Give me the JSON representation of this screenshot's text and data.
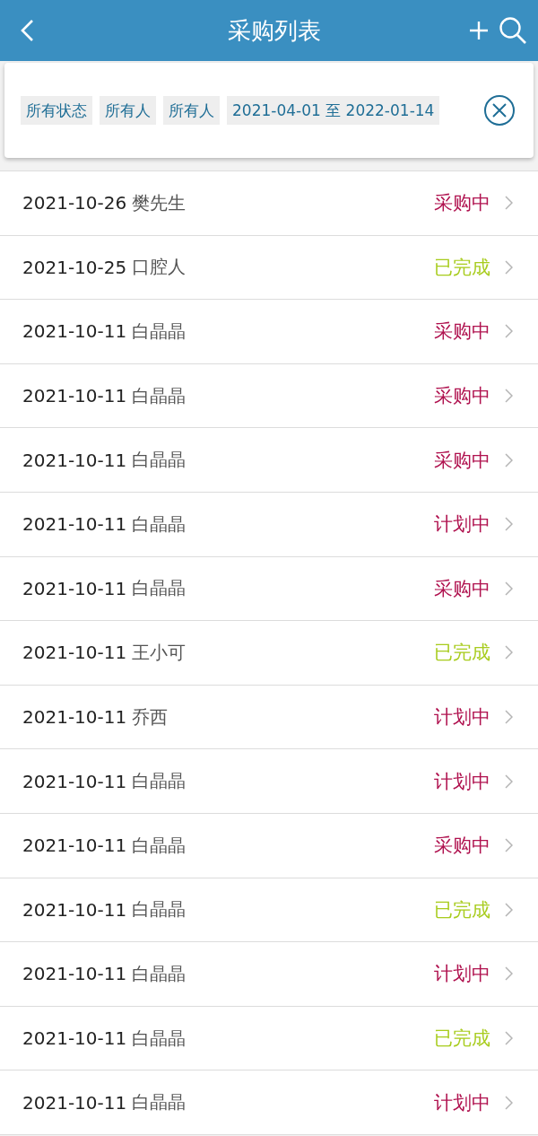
{
  "header": {
    "title": "采购列表"
  },
  "filters": [
    "所有状态",
    "所有人",
    "所有人",
    "2021-04-01 至 2022-01-14"
  ],
  "orders": [
    {
      "date": "2021-10-26",
      "person": "樊先生",
      "status": "采购中",
      "color": "#b0124f"
    },
    {
      "date": "2021-10-25",
      "person": "口腔人",
      "status": "已完成",
      "color": "#a8cc1e"
    },
    {
      "date": "2021-10-11",
      "person": "白晶晶",
      "status": "采购中",
      "color": "#b0124f"
    },
    {
      "date": "2021-10-11",
      "person": "白晶晶",
      "status": "采购中",
      "color": "#b0124f"
    },
    {
      "date": "2021-10-11",
      "person": "白晶晶",
      "status": "采购中",
      "color": "#b0124f"
    },
    {
      "date": "2021-10-11",
      "person": "白晶晶",
      "status": "计划中",
      "color": "#b0124f"
    },
    {
      "date": "2021-10-11",
      "person": "白晶晶",
      "status": "采购中",
      "color": "#b0124f"
    },
    {
      "date": "2021-10-11",
      "person": "王小可",
      "status": "已完成",
      "color": "#a8cc1e"
    },
    {
      "date": "2021-10-11",
      "person": "乔西",
      "status": "计划中",
      "color": "#b0124f"
    },
    {
      "date": "2021-10-11",
      "person": "白晶晶",
      "status": "计划中",
      "color": "#b0124f"
    },
    {
      "date": "2021-10-11",
      "person": "白晶晶",
      "status": "采购中",
      "color": "#b0124f"
    },
    {
      "date": "2021-10-11",
      "person": "白晶晶",
      "status": "已完成",
      "color": "#a8cc1e"
    },
    {
      "date": "2021-10-11",
      "person": "白晶晶",
      "status": "计划中",
      "color": "#b0124f"
    },
    {
      "date": "2021-10-11",
      "person": "白晶晶",
      "status": "已完成",
      "color": "#a8cc1e"
    },
    {
      "date": "2021-10-11",
      "person": "白晶晶",
      "status": "计划中",
      "color": "#b0124f"
    }
  ]
}
